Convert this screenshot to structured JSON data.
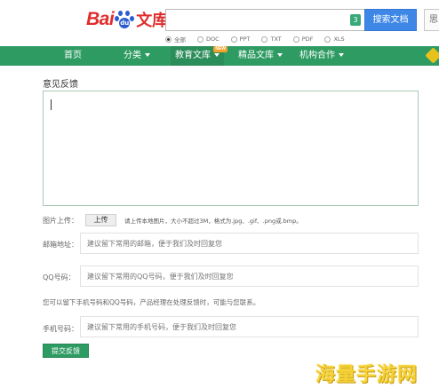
{
  "header": {
    "logo": {
      "bai": "Bai",
      "du": "du",
      "wenku": "文库"
    },
    "search": {
      "placeholder": "",
      "badge": "3",
      "button_label": "搜索文档"
    },
    "corner_label": "思",
    "filters": [
      {
        "label": "全部",
        "checked": true
      },
      {
        "label": "DOC",
        "checked": false
      },
      {
        "label": "PPT",
        "checked": false
      },
      {
        "label": "TXT",
        "checked": false
      },
      {
        "label": "PDF",
        "checked": false
      },
      {
        "label": "XLS",
        "checked": false
      }
    ]
  },
  "nav": {
    "items": [
      {
        "label": "首页",
        "dropdown": false
      },
      {
        "label": "分类",
        "dropdown": true
      },
      {
        "label": "教育文库",
        "dropdown": true,
        "badge": "NEW"
      },
      {
        "label": "精品文库",
        "dropdown": true
      },
      {
        "label": "机构合作",
        "dropdown": true
      }
    ],
    "colors": {
      "background": "#2e9b63",
      "active": "#2b8d59"
    }
  },
  "form": {
    "title": "意见反馈",
    "upload": {
      "label": "图片上传：",
      "button_label": "上传",
      "hint": "请上传本地图片，大小不超过3M，格式为.jpg、.gif、.png或.bmp。"
    },
    "email": {
      "label": "邮箱地址：",
      "placeholder": "建议留下常用的邮箱，便于我们及时回复您"
    },
    "qq": {
      "label": "QQ号码：",
      "placeholder": "建议留下常用的QQ号码，便于我们及时回复您"
    },
    "notice": "您可以留下手机号码和QQ号码，产品经理在处理反馈时，可能与您联系。",
    "phone": {
      "label": "手机号码：",
      "placeholder": "建议留下常用的手机号码，便于我们及时回复您"
    },
    "submit_label": "提交反馈"
  },
  "watermark": "海量手游网"
}
